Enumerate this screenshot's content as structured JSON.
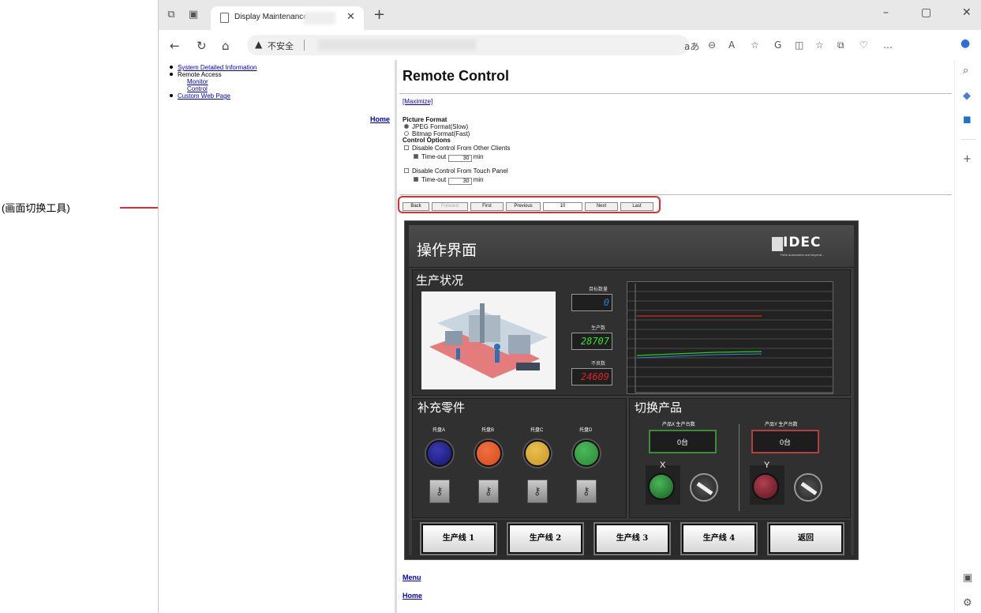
{
  "annotation": {
    "label": "(画面切换工具)"
  },
  "browser": {
    "tab_title": "Display Maintenance",
    "insecure_label": "不安全"
  },
  "left_nav": {
    "items": [
      {
        "label": "System Detailed Information"
      },
      {
        "label": "Remote Access"
      },
      {
        "label": "Monitor"
      },
      {
        "label": "Control"
      },
      {
        "label": "Custom Web Page"
      }
    ],
    "home": "Home"
  },
  "remote": {
    "title": "Remote Control",
    "maximize": "[Maximize]",
    "picture_format": "Picture Format",
    "jpeg": "JPEG Format(Slow)",
    "bitmap": "Bitmap Format(Fast)",
    "control_options": "Control Options",
    "disable_clients": "Disable Control From Other Clients",
    "timeout_label": "Time-out",
    "timeout1": "30",
    "min": "min",
    "disable_touch": "Disable Control From Touch Panel",
    "timeout2": "30",
    "nav": {
      "back": "Back",
      "forward": "Forward",
      "first": "First",
      "previous": "Previous",
      "page": "10",
      "next": "Next",
      "last": "Last"
    },
    "menu": "Menu",
    "home": "Home"
  },
  "hmi": {
    "title": "操作界面",
    "logo": "IDEC",
    "logo_sub": "Think Automation and beyond...",
    "production": {
      "title": "生产状况",
      "target_label": "目标数量",
      "target_value": "0",
      "produced_label": "生产数",
      "produced_value": "28707",
      "defect_label": "不良数",
      "defect_value": "24609"
    },
    "parts": {
      "title": "补充零件",
      "trays": [
        {
          "label": "托盘A",
          "color": "#14146e"
        },
        {
          "label": "托盘B",
          "color": "#d64a1c"
        },
        {
          "label": "托盘C",
          "color": "#c99520"
        },
        {
          "label": "托盘D",
          "color": "#2a8a38"
        }
      ]
    },
    "switch": {
      "title": "切换产品",
      "x_label": "产品X 生产台数",
      "x_value": "0台",
      "y_label": "产品Y 生产台数",
      "y_value": "0台",
      "x": "X",
      "y": "Y"
    },
    "lines": [
      "生产线 1",
      "生产线 2",
      "生产线 3",
      "生产线 4",
      "返回"
    ],
    "colors": {
      "target": "#2a7bd6",
      "produced": "#35e035",
      "defect": "#e02020"
    }
  }
}
